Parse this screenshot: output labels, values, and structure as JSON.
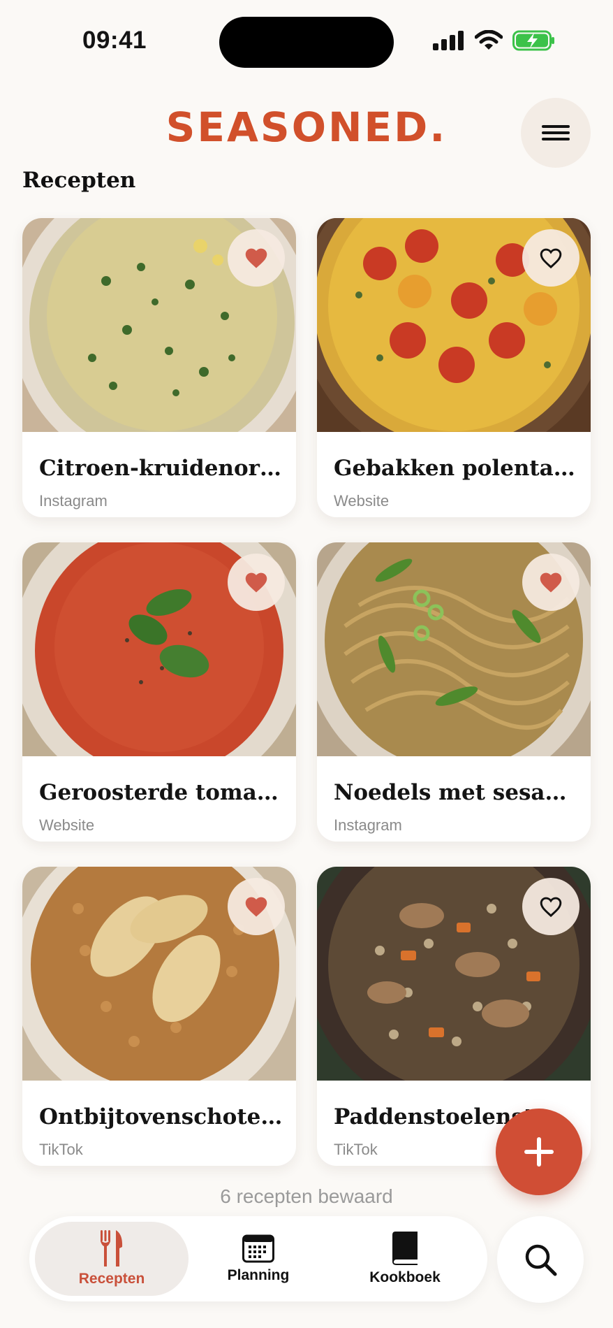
{
  "status": {
    "time": "09:41"
  },
  "header": {
    "brand": "SEASONED."
  },
  "section": {
    "title": "Recepten"
  },
  "recipes": [
    {
      "title": "Citroen-kruidenorzo",
      "source": "Instagram",
      "favorite": true
    },
    {
      "title": "Gebakken polenta met tomaatjes",
      "source": "Website",
      "favorite": false
    },
    {
      "title": "Geroosterde tomatensoep",
      "source": "Website",
      "favorite": true
    },
    {
      "title": "Noedels met sesam en groene groenten",
      "source": "Instagram",
      "favorite": true
    },
    {
      "title": "Ontbijtovenschotel met peer",
      "source": "TikTok",
      "favorite": true
    },
    {
      "title": "Paddenstoelenstoofpot",
      "source": "TikTok",
      "favorite": false
    }
  ],
  "footer": {
    "count_text": "6 recepten bewaard"
  },
  "nav": {
    "tabs": [
      {
        "label": "Recepten",
        "icon": "fork-knife-icon",
        "active": true
      },
      {
        "label": "Planning",
        "icon": "calendar-icon",
        "active": false
      },
      {
        "label": "Kookboek",
        "icon": "book-icon",
        "active": false
      }
    ]
  },
  "colors": {
    "brand": "#d1502b",
    "accent": "#d04e35",
    "heart": "#d05b4a"
  }
}
